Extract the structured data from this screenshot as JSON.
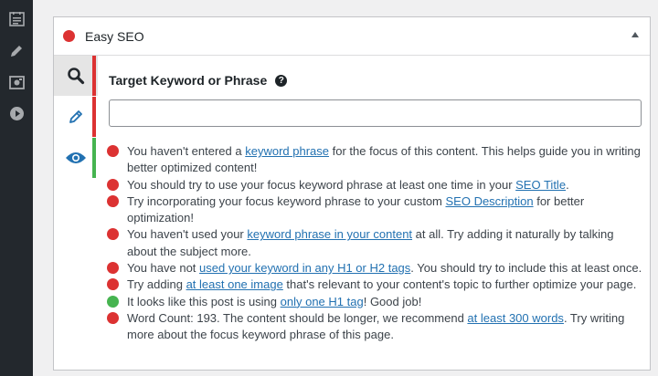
{
  "colors": {
    "bad": "#dc3232",
    "good": "#46b450",
    "link": "#2271b1"
  },
  "admin_sidebar": {
    "icons": [
      "dashboard-icon",
      "pencil-icon",
      "media-icon",
      "play-icon"
    ]
  },
  "panel": {
    "title": "Easy SEO",
    "status": "bad",
    "tabs": [
      {
        "icon": "search-icon",
        "status": "bad",
        "active": true
      },
      {
        "icon": "pencil-icon",
        "status": "bad",
        "active": false
      },
      {
        "icon": "eye-icon",
        "status": "good",
        "active": false
      }
    ],
    "field": {
      "label": "Target Keyword or Phrase",
      "help": "?",
      "value": "",
      "placeholder": ""
    },
    "checks": [
      {
        "status": "bad",
        "before": "You haven't entered a ",
        "link": "keyword phrase",
        "after": " for the focus of this content. This helps guide you in writing better optimized content!"
      },
      {
        "status": "bad",
        "before": "You should try to use your focus keyword phrase at least one time in your ",
        "link": "SEO Title",
        "after": "."
      },
      {
        "status": "bad",
        "before": "Try incorporating your focus keyword phrase to your custom ",
        "link": "SEO Description",
        "after": " for better optimization!"
      },
      {
        "status": "bad",
        "before": "You haven't used your ",
        "link": "keyword phrase in your content",
        "after": " at all. Try adding it naturally by talking about the subject more."
      },
      {
        "status": "bad",
        "before": "You have not ",
        "link": "used your keyword in any H1 or H2 tags",
        "after": ". You should try to include this at least once."
      },
      {
        "status": "bad",
        "before": "Try adding ",
        "link": "at least one image",
        "after": " that's relevant to your content's topic to further optimize your page."
      },
      {
        "status": "good",
        "before": "It looks like this post is using ",
        "link": "only one H1 tag",
        "after": "! Good job!"
      },
      {
        "status": "bad",
        "before": "Word Count: 193. The content should be longer, we recommend ",
        "link": "at least 300 words",
        "after": ". Try writing more about the focus keyword phrase of this page."
      }
    ]
  }
}
